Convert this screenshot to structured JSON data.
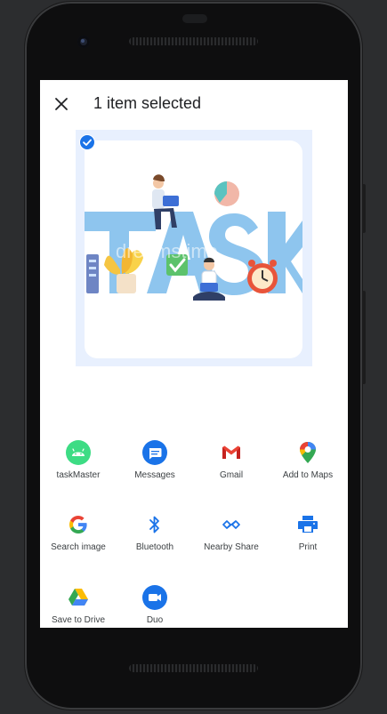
{
  "header": {
    "title": "1 item selected"
  },
  "preview": {
    "image_text": "TASK",
    "watermark": "dreamstime"
  },
  "share_targets": [
    {
      "label": "taskMaster",
      "icon": "android-icon"
    },
    {
      "label": "Messages",
      "icon": "messages-icon"
    },
    {
      "label": "Gmail",
      "icon": "gmail-icon"
    },
    {
      "label": "Add to Maps",
      "icon": "maps-pin-icon"
    },
    {
      "label": "Search image",
      "icon": "google-icon"
    },
    {
      "label": "Bluetooth",
      "icon": "bluetooth-icon"
    },
    {
      "label": "Nearby Share",
      "icon": "nearby-share-icon"
    },
    {
      "label": "Print",
      "icon": "print-icon"
    },
    {
      "label": "Save to Drive",
      "icon": "drive-icon"
    },
    {
      "label": "Duo",
      "icon": "duo-icon"
    }
  ],
  "colors": {
    "accent_blue": "#1a73e8",
    "android_green": "#3ddc84",
    "preview_bg": "#e8f0fe"
  }
}
